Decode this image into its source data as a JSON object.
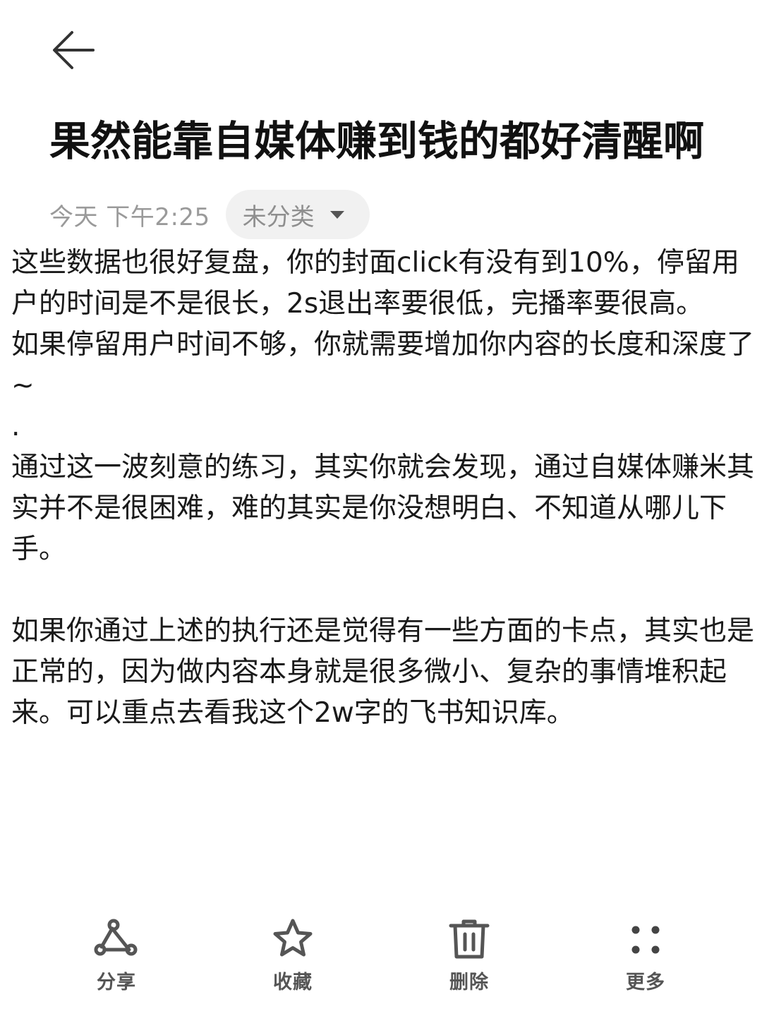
{
  "header": {
    "back_icon": "arrow-left-icon"
  },
  "note": {
    "title": "果然能靠自媒体赚到钱的都好清醒啊",
    "timestamp": "今天 下午2:25",
    "category": "未分类",
    "paragraphs": [
      "这些数据也很好复盘，你的封面click有没有到10%，停留用户的时间是不是很长，2s退出率要很低，完播率要很高。",
      "如果停留用户时间不够，你就需要增加你内容的长度和深度了~",
      ".",
      "通过这一波刻意的练习，其实你就会发现，通过自媒体赚米其实并不是很困难，难的其实是你没想明白、不知道从哪儿下手。",
      " ",
      "如果你通过上述的执行还是觉得有一些方面的卡点，其实也是正常的，因为做内容本身就是很多微小、复杂的事情堆积起来。可以重点去看我这个2w字的飞书知识库。"
    ]
  },
  "toolbar": {
    "share_label": "分享",
    "favorite_label": "收藏",
    "delete_label": "删除",
    "more_label": "更多",
    "icons": [
      "share-icon",
      "star-icon",
      "trash-icon",
      "more-icon"
    ]
  },
  "colors": {
    "text_primary": "#111111",
    "text_secondary": "#9a9a9a",
    "chip_background": "#f1f1f1",
    "toolbar_icon": "#555555"
  }
}
